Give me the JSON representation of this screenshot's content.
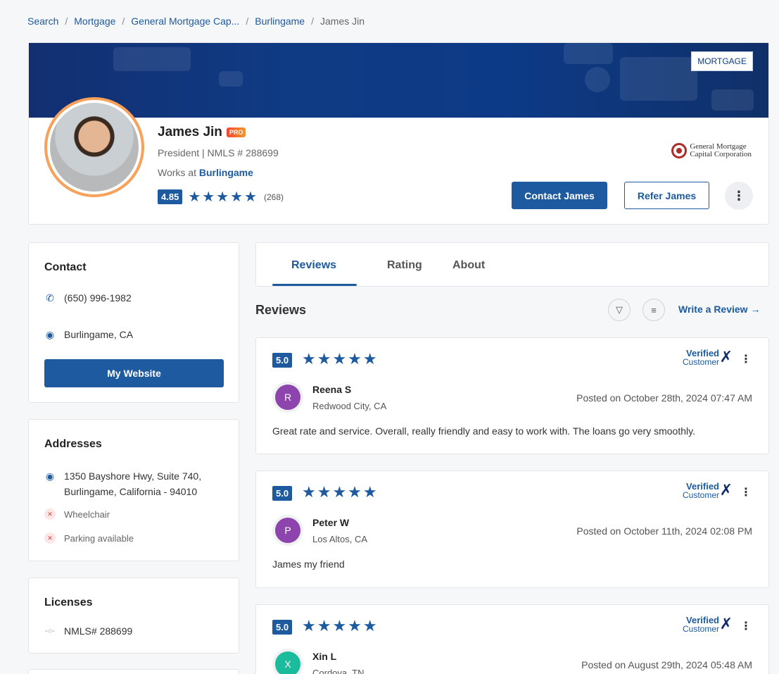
{
  "breadcrumb": [
    "Search",
    "Mortgage",
    "General Mortgage Cap...",
    "Burlingame",
    "James Jin"
  ],
  "profile": {
    "tag": "MORTGAGE",
    "name": "James Jin",
    "badge": "PRO",
    "title": "President | NMLS # 288699",
    "works_prefix": "Works at",
    "works_at": "Burlingame",
    "rating": "4.85",
    "review_count": "(268)",
    "company_line1": "General Mortgage",
    "company_line2": "Capital Corporation",
    "contact_button": "Contact James",
    "refer_button": "Refer James"
  },
  "contact": {
    "heading": "Contact",
    "phone": "(650) 996-1982",
    "location": "Burlingame, CA",
    "website_button": "My Website"
  },
  "addresses": {
    "heading": "Addresses",
    "line1": "1350 Bayshore Hwy, Suite 740,",
    "line2": "Burlingame, California - 94010",
    "amenities": [
      "Wheelchair",
      "Parking available"
    ]
  },
  "licenses": {
    "heading": "Licenses",
    "items": [
      "NMLS# 288699"
    ]
  },
  "tabs": [
    "Reviews",
    "Rating",
    "About"
  ],
  "reviews_section": {
    "heading": "Reviews",
    "write_link": "Write a Review →",
    "verified_line1": "Verified",
    "verified_line2": "Customer"
  },
  "reviews": [
    {
      "score": "5.0",
      "initial": "R",
      "name": "Reena S",
      "location": "Redwood City, CA",
      "date": "Posted on October 28th, 2024 07:47 AM",
      "text": "Great rate and service. Overall, really friendly and easy to work with. The loans go very smoothly.",
      "avatar_color": "#8e44ad"
    },
    {
      "score": "5.0",
      "initial": "P",
      "name": "Peter W",
      "location": "Los Altos, CA",
      "date": "Posted on October 11th, 2024 02:08 PM",
      "text": "James my friend",
      "avatar_color": "#8e44ad"
    },
    {
      "score": "5.0",
      "initial": "X",
      "name": "Xin L",
      "location": "Cordova, TN",
      "date": "Posted on August 29th, 2024 05:48 AM",
      "text": "",
      "avatar_color": "#1abc9c"
    }
  ]
}
